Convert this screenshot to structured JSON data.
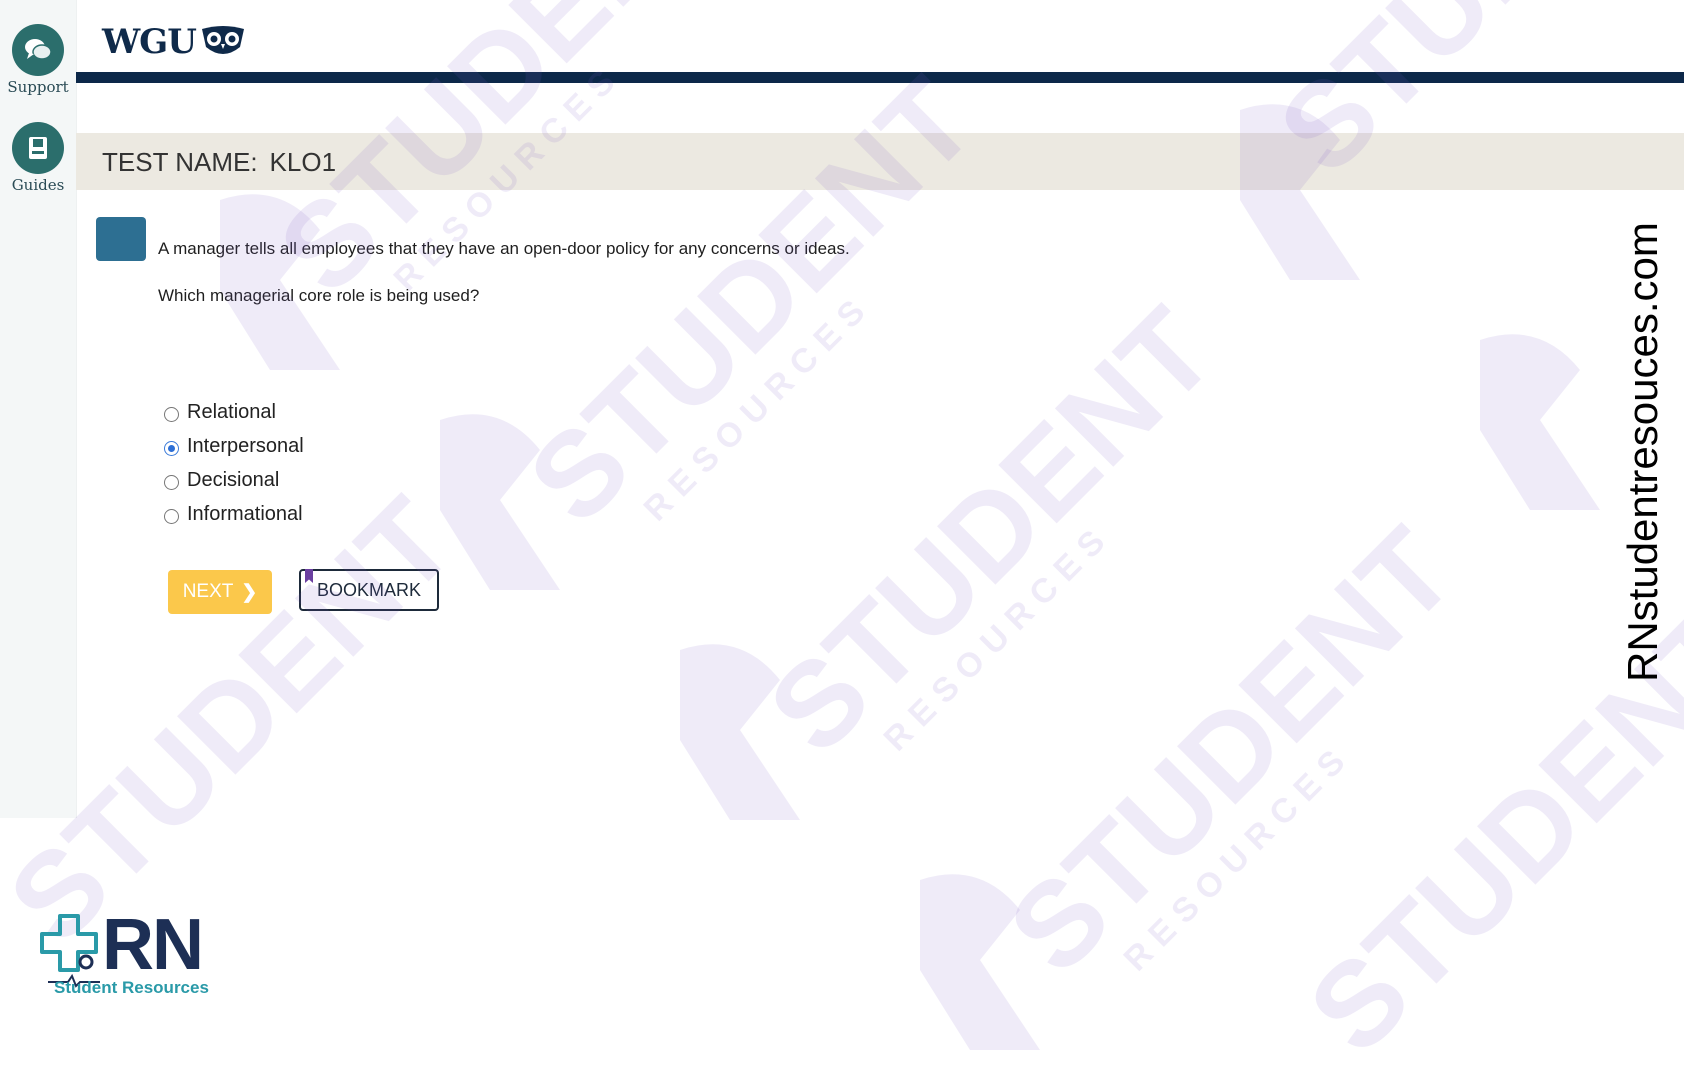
{
  "sidebar": {
    "items": [
      {
        "label": "Support",
        "icon": "chat-icon"
      },
      {
        "label": "Guides",
        "icon": "book-icon"
      }
    ]
  },
  "header": {
    "logo_text": "WGU",
    "test_name_label": "TEST NAME:",
    "test_name_value": "KLO1"
  },
  "question": {
    "prompt": "A manager tells all employees that they have an open-door policy for any concerns or ideas.",
    "sub_prompt": "Which managerial core role is being used?",
    "options": [
      {
        "label": "Relational",
        "selected": false
      },
      {
        "label": "Interpersonal",
        "selected": true
      },
      {
        "label": "Decisional",
        "selected": false
      },
      {
        "label": "Informational",
        "selected": false
      }
    ]
  },
  "actions": {
    "next_label": "NEXT",
    "bookmark_label": "BOOKMARK"
  },
  "watermark": {
    "side_url": "RNstudentresouces.com",
    "logo_main": "RN",
    "logo_sub": "Student Resources",
    "repeated_text": "STUDENT",
    "repeated_subtext": "RESOURCES"
  },
  "colors": {
    "nav_dark": "#0c2849",
    "sidebar_icon": "#2b6e6c",
    "next_button": "#fbc84b",
    "radio_selected": "#2c6fd6",
    "test_bar": "#ece9e1",
    "watermark": "#7d5bc8"
  }
}
